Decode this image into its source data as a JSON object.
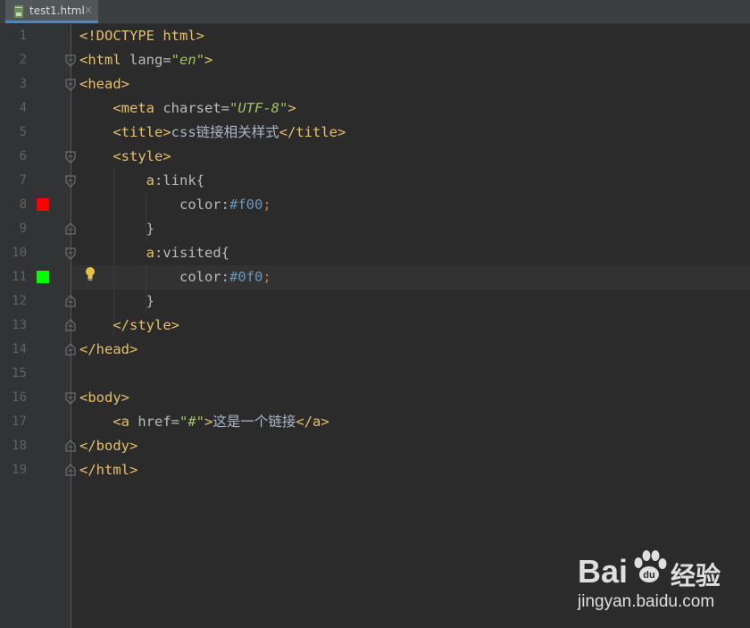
{
  "tab": {
    "filename": "test1.html",
    "close_glyph": "×",
    "icon": "html-file-icon"
  },
  "line_numbers": [
    "1",
    "2",
    "3",
    "4",
    "5",
    "6",
    "7",
    "8",
    "9",
    "10",
    "11",
    "12",
    "13",
    "14",
    "15",
    "16",
    "17",
    "18",
    "19"
  ],
  "code": {
    "l1": {
      "text": "<!DOCTYPE html>"
    },
    "l2": {
      "open": "<html",
      "attr": " lang=",
      "val": "\"en\"",
      "close": ">"
    },
    "l3": {
      "text": "<head>"
    },
    "l4": {
      "indent": "    ",
      "open": "<meta",
      "attr": " charset=",
      "val": "\"UTF-8\"",
      "close": ">"
    },
    "l5": {
      "indent": "    ",
      "open": "<title>",
      "text": "css链接相关样式",
      "close": "</title>"
    },
    "l6": {
      "indent": "    ",
      "text": "<style>"
    },
    "l7": {
      "indent": "        ",
      "sel": "a",
      "pseudo": ":link",
      "brace": "{"
    },
    "l8": {
      "indent": "            ",
      "prop": "color",
      "colon": ":",
      "value": "#f00",
      "semi": ";"
    },
    "l9": {
      "indent": "        ",
      "brace": "}"
    },
    "l10": {
      "indent": "        ",
      "sel": "a",
      "pseudo": ":visited",
      "brace": "{"
    },
    "l11": {
      "indent": "            ",
      "prop": "color",
      "colon": ":",
      "value": "#0f0",
      "semi": ";"
    },
    "l12": {
      "indent": "        ",
      "brace": "}"
    },
    "l13": {
      "indent": "    ",
      "text": "</style>"
    },
    "l14": {
      "text": "</head>"
    },
    "l16": {
      "text": "<body>"
    },
    "l17": {
      "indent": "    ",
      "open": "<a",
      "attr": " href=",
      "val": "\"#\"",
      "close": ">",
      "text": "这是一个链接",
      "end": "</a>"
    },
    "l18": {
      "text": "</body>"
    },
    "l19": {
      "text": "</html>"
    }
  },
  "swatches": {
    "line8": "#ff0000",
    "line11": "#00ff00"
  },
  "icons": {
    "fold": "fold-marker-icon",
    "intention": "lightbulb-icon"
  },
  "watermark": {
    "brand_left": "Bai",
    "brand_right": "经验",
    "url": "jingyan.baidu.com"
  }
}
